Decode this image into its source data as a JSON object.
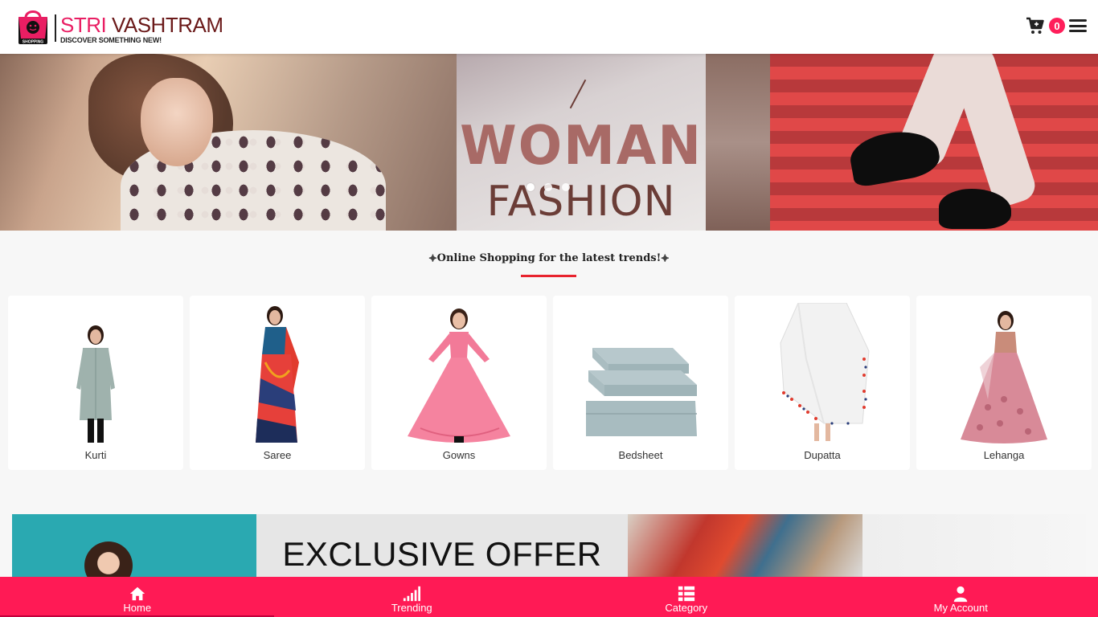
{
  "brand": {
    "title_part1": "STRI ",
    "title_part2": "VASHTRAM",
    "tagline": "DISCOVER SOMETHING NEW!",
    "bag_text": "SHOPPING",
    "primary_color": "#e91e63",
    "secondary_color": "#6b1a1a"
  },
  "header": {
    "cart_icon": "cart-plus-icon",
    "cart_count": "0",
    "menu_icon": "hamburger-menu-icon"
  },
  "hero": {
    "slide_text_line1": "WOMAN",
    "slide_text_line2": "FASHION",
    "slide_count": 3,
    "active_slide": 0
  },
  "section": {
    "title": "Online Shopping for the latest trends!",
    "accent_color": "#e8232e"
  },
  "categories": [
    {
      "label": "Kurti"
    },
    {
      "label": "Saree"
    },
    {
      "label": "Gowns"
    },
    {
      "label": "Bedsheet"
    },
    {
      "label": "Dupatta"
    },
    {
      "label": "Lehanga"
    }
  ],
  "offer": {
    "text": "EXCLUSIVE OFFER"
  },
  "bottom_nav": {
    "color": "#ff1a55",
    "items": [
      {
        "label": "Home",
        "icon": "home-icon"
      },
      {
        "label": "Trending",
        "icon": "signal-bars-icon"
      },
      {
        "label": "Category",
        "icon": "list-icon"
      },
      {
        "label": "My Account",
        "icon": "user-icon"
      }
    ]
  }
}
